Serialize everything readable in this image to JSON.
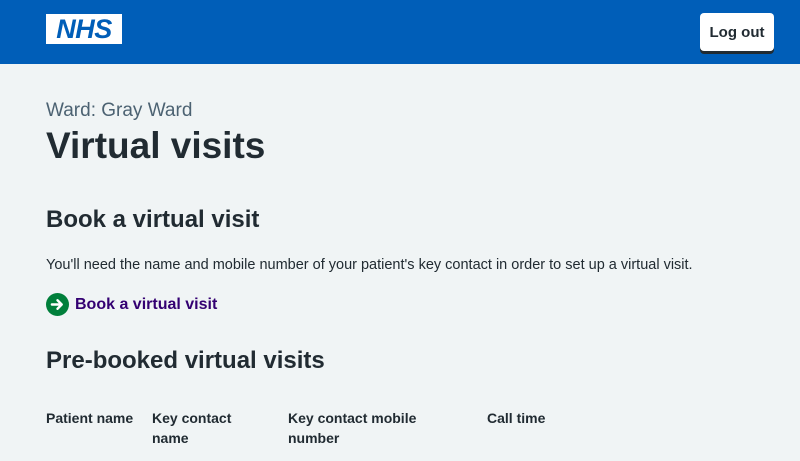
{
  "header": {
    "logo_text": "NHS",
    "logout_label": "Log out",
    "brand_color": "#005eb8"
  },
  "page": {
    "ward": "Ward: Gray Ward",
    "title": "Virtual visits"
  },
  "book": {
    "heading": "Book a virtual visit",
    "description": "You'll need the name and mobile number of your patient's key contact in order to set up a virtual visit.",
    "action_label": "Book a virtual visit",
    "action_icon": "arrow-right-circle-icon",
    "action_color": "#007f3b",
    "link_color": "#330072"
  },
  "prebooked": {
    "heading": "Pre-booked virtual visits",
    "columns": [
      "Patient name",
      "Key contact name",
      "Key contact mobile number",
      "Call time"
    ]
  }
}
